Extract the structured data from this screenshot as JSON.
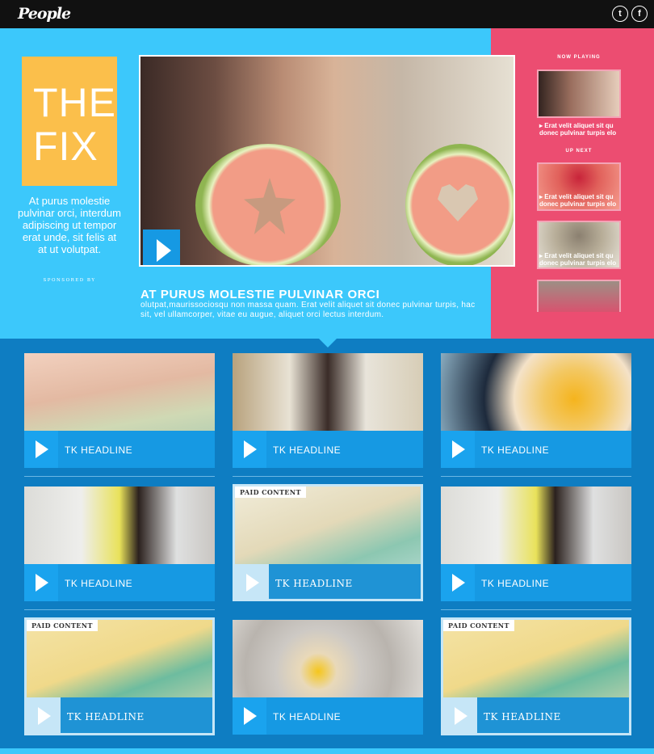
{
  "brand": {
    "logo": "People"
  },
  "social": {
    "twitter_icon": "t",
    "facebook_icon": "f"
  },
  "series": {
    "title_line1": "THE",
    "title_line2": "FIX",
    "description": "At purus molestie pulvinar orci, interdum adipiscing ut tempor erat unde, sit felis at at ut volutpat.",
    "sponsored_label": "SPONSORED BY"
  },
  "featured": {
    "title": "AT PURUS MOLESTIE PULVINAR ORCI",
    "description": "olutpat,maurissociosqu non massa quam. Erat velit aliquet sit donec pulvinar turpis, hac sit, vel ullamcorper, vitae eu augue, aliquet orci lectus interdum."
  },
  "rail": {
    "now_playing_label": "NOW PLAYING",
    "up_next_label": "UP NEXT",
    "now_playing_caption": "Erat velit aliquet sit qu donec pulvinar turpis elo",
    "up_next_items": [
      {
        "caption": "Erat velit aliquet sit qu donec pulvinar turpis elo"
      },
      {
        "caption": "Erat velit aliquet sit qu donec pulvinar turpis elo"
      }
    ]
  },
  "videos": [
    {
      "headline": "TK HEADLINE",
      "paid_label": ""
    },
    {
      "headline": "TK HEADLINE",
      "paid_label": ""
    },
    {
      "headline": "TK HEADLINE",
      "paid_label": ""
    },
    {
      "headline": "TK HEADLINE",
      "paid_label": ""
    },
    {
      "headline": "TK HEADLINE",
      "paid_label": "PAID CONTENT"
    },
    {
      "headline": "TK HEADLINE",
      "paid_label": ""
    },
    {
      "headline": "TK HEADLINE",
      "paid_label": "PAID CONTENT"
    },
    {
      "headline": "TK HEADLINE",
      "paid_label": ""
    },
    {
      "headline": "TK HEADLINE",
      "paid_label": "PAID CONTENT"
    }
  ],
  "colors": {
    "hero_bg": "#3cc8fb",
    "rail_bg": "#ec4d71",
    "grid_bg": "#0e7dc2",
    "accent": "#1699e3",
    "fix_box": "#fbbf4b"
  },
  "icons": {
    "play": "play-icon"
  }
}
